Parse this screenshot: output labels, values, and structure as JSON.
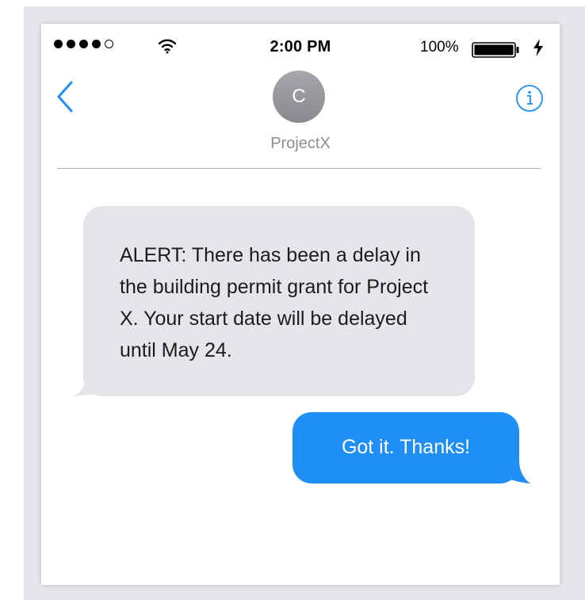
{
  "status_bar": {
    "signal_dots_filled": 4,
    "signal_dots_total": 5,
    "time": "2:00 PM",
    "battery_percent": "100%",
    "battery_level": 1.0
  },
  "nav": {
    "back_icon": "chevron-left-icon",
    "info_icon": "info-circle-icon",
    "avatar_initial": "C",
    "contact_name": "ProjectX"
  },
  "messages": [
    {
      "direction": "incoming",
      "text": "ALERT: There has been a delay in the building permit grant for Project X. Your start date will be delayed until May 24."
    },
    {
      "direction": "outgoing",
      "text": "Got it. Thanks!"
    }
  ],
  "colors": {
    "accent": "#1f8ff5",
    "incoming_bubble": "#e5e5ea",
    "avatar": "#9a9a9e",
    "contact_name": "#8e8e93"
  }
}
